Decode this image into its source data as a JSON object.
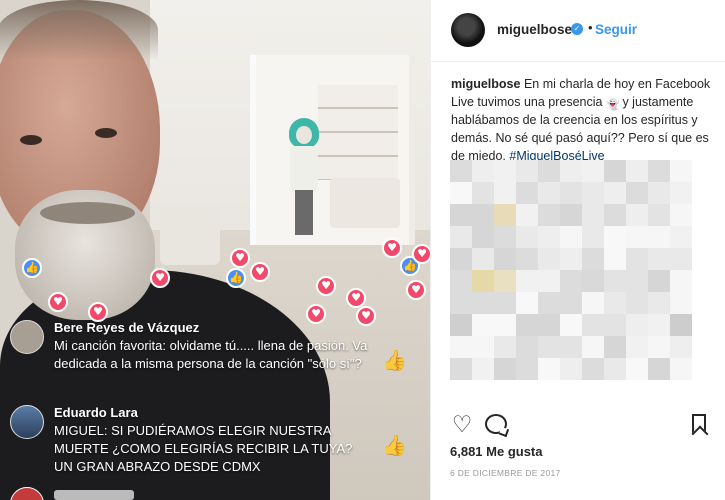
{
  "video": {
    "comments": [
      {
        "name": "Bere Reyes de Vázquez",
        "text": "Mi canción favorita: olvidame tú..... llena de pasión. Va dedicada a la misma persona de la canción \"sólo sí\"?"
      },
      {
        "name": "Eduardo Lara",
        "text": "MIGUEL: SI PUDIÉRAMOS ELEGIR NUESTRA MUERTE ¿COMO ELEGIRÍAS RECIBIR LA TUYA? UN GRAN ABRAZO DESDE CDMX"
      }
    ],
    "reactions": {
      "love_icon": "heart-reaction-icon",
      "like_icon": "thumbs-up-reaction-icon",
      "love_color": "#f2496a",
      "like_color": "#4b8ff5"
    }
  },
  "post": {
    "username": "miguelbose",
    "follow_label": "Seguir",
    "caption": {
      "user": "miguelbose",
      "text_before": "En mi charla de hoy en Facebook Live tuvimos una presencia",
      "text_after": "y justamente hablábamos de la creencia en los espíritus y demás. No sé qué pasó aquí?? Pero sí que es de miedo.",
      "hashtag": "#MiguelBoséLive"
    },
    "likes": "6,881 Me gusta",
    "date": "6 DE DICIEMBRE DE 2017",
    "accent_color": "#3897f0"
  }
}
